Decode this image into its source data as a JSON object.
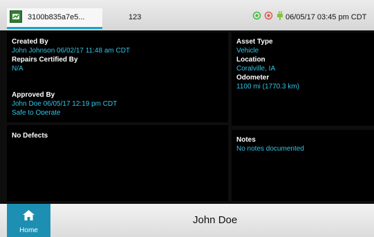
{
  "topbar": {
    "document_id": "3100b835a7e5...",
    "tab_count": "123",
    "datetime": "06/05/17 03:45 pm CDT",
    "status_icons": [
      "gps-icon",
      "engine-icon",
      "power-icon"
    ],
    "colors": {
      "gps": "#3cbf3c",
      "engine": "#e0584f",
      "power": "#86c23a"
    }
  },
  "inspection": {
    "created_by_label": "Created By",
    "created_by_value": "John Johnson 06/02/17 11:48 am CDT",
    "repairs_label": "Repairs Certified By",
    "repairs_value": "N/A",
    "approved_by_label": "Approved By",
    "approved_by_value": "John Doe 06/05/17 12:19 pm CDT",
    "approved_status": "Safe to Operate"
  },
  "asset": {
    "type_label": "Asset Type",
    "type_value": "Vehicle",
    "location_label": "Location",
    "location_value": "Coralville, IA",
    "odometer_label": "Odometer",
    "odometer_value": "1100 mi (1770.3 km)"
  },
  "defects": {
    "title": "No Defects"
  },
  "notes": {
    "title": "Notes",
    "value": "No notes documented"
  },
  "footer": {
    "home_label": "Home",
    "driver_name": "John Doe"
  },
  "colors": {
    "accent": "#1c8fb3",
    "value_text": "#33c5e6",
    "panel_bg": "#000000"
  }
}
